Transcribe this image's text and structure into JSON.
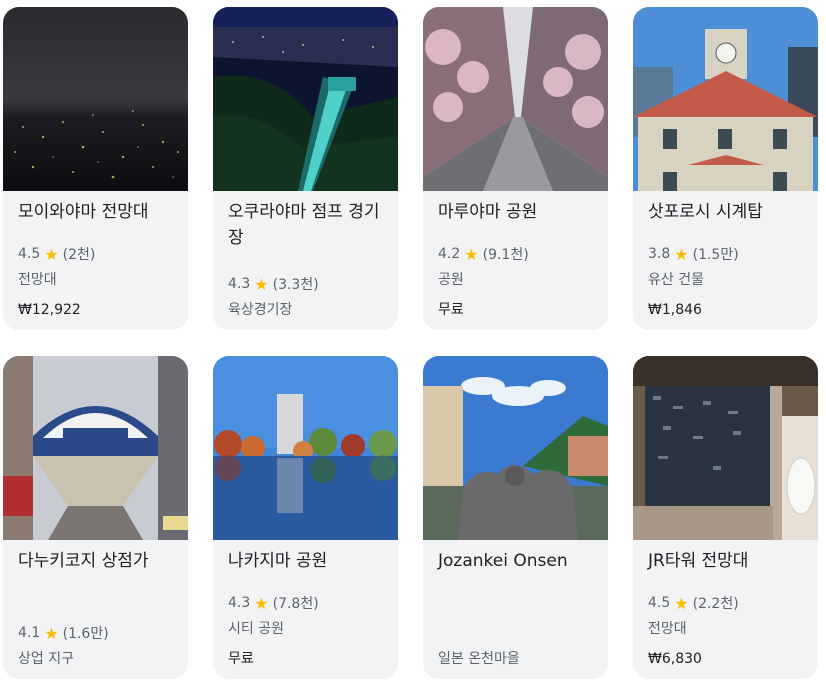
{
  "cards": [
    {
      "title": "모이와야마 전망대",
      "rating": "4.5",
      "count": "(2천)",
      "category": "전망대",
      "price": "₩12,922",
      "photo": "city-night-view-photo"
    },
    {
      "title": "오쿠라야마 점프 경기장",
      "rating": "4.3",
      "count": "(3.3천)",
      "category": "육상경기장",
      "price": "",
      "photo": "ski-jump-night-photo"
    },
    {
      "title": "마루야마 공원",
      "rating": "4.2",
      "count": "(9.1천)",
      "category": "공원",
      "price": "무료",
      "photo": "cherry-blossom-path-photo"
    },
    {
      "title": "삿포로시 시계탑",
      "rating": "3.8",
      "count": "(1.5만)",
      "category": "유산 건물",
      "price": "₩1,846",
      "photo": "clock-tower-photo"
    },
    {
      "title": "다누키코지 상점가",
      "rating": "4.1",
      "count": "(1.6만)",
      "category": "상업 지구",
      "price": "",
      "photo": "shopping-arcade-photo"
    },
    {
      "title": "나카지마 공원",
      "rating": "4.3",
      "count": "(7.8천)",
      "category": "시티 공원",
      "price": "무료",
      "photo": "park-pond-photo"
    },
    {
      "title": "Jozankei Onsen",
      "rating": "",
      "count": "",
      "category": "일본 온천마을",
      "price": "",
      "photo": "onsen-statue-photo"
    },
    {
      "title": "JR타워 전망대",
      "rating": "4.5",
      "count": "(2.2천)",
      "category": "전망대",
      "price": "₩6,830",
      "photo": "tower-observatory-photo"
    }
  ],
  "colors": {
    "card_bg": "#f1f3f4",
    "star": "#fbbc04",
    "text_primary": "#202124",
    "text_secondary": "#5f6368"
  },
  "icons": {
    "rating": "star-icon"
  }
}
